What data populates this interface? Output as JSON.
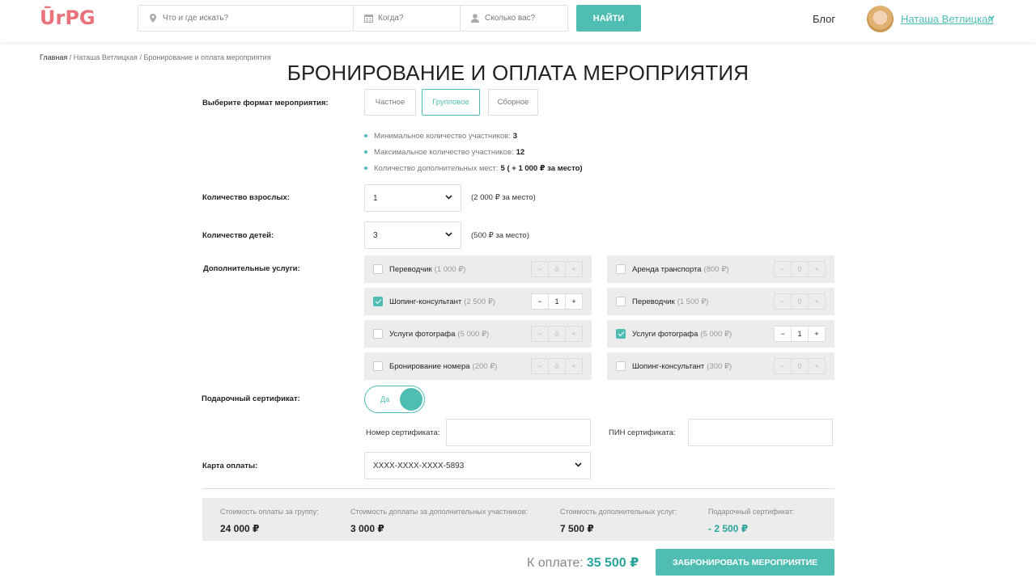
{
  "header": {
    "logo": "ŪrPG",
    "search": {
      "where_placeholder": "Что и где искать?",
      "when_placeholder": "Когда?",
      "who_placeholder": "Сколько вас?",
      "find_label": "НАЙТИ"
    },
    "blog_label": "Блог",
    "user_name": "Наташа Ветлицкая"
  },
  "breadcrumb": {
    "home": "Главная",
    "sep1": " / ",
    "user": "Наташа Ветлицкая",
    "sep2": " / ",
    "current": "Бронирование и оплата мероприятия"
  },
  "page_title": "БРОНИРОВАНИЕ И ОПЛАТА МЕРОПРИЯТИЯ",
  "format": {
    "label": "Выберите формат мероприятия:",
    "options": [
      "Частное",
      "Групповое",
      "Сборное"
    ],
    "selected": "Групповое"
  },
  "info": {
    "min_label": "Минимальное количество участников:",
    "min_value": "3",
    "max_label": "Максимальное количество участников:",
    "max_value": "12",
    "extra_label": "Количество дополнительных мест:",
    "extra_value": "5 ( + 1 000 ₽  за место)"
  },
  "adults": {
    "label": "Количество взрослых:",
    "value": "1",
    "note": "(2 000 ₽  за место)"
  },
  "children": {
    "label": "Количество детей:",
    "value": "3",
    "note": "(500 ₽  за место)"
  },
  "services": {
    "label": "Дополнительные услуги:",
    "left": [
      {
        "name": "Переводчик",
        "price": "(1 000 ₽)",
        "checked": false,
        "qty": "0"
      },
      {
        "name": "Шопинг-консультант",
        "price": "(2 500 ₽)",
        "checked": true,
        "qty": "1"
      },
      {
        "name": "Услуги фотографа",
        "price": "(5 000 ₽)",
        "checked": false,
        "qty": "0"
      },
      {
        "name": "Бронирование номера",
        "price": "(200 ₽)",
        "checked": false,
        "qty": "0"
      }
    ],
    "right": [
      {
        "name": "Аренда транспорта",
        "price": "(800 ₽)",
        "checked": false,
        "qty": "0"
      },
      {
        "name": "Переводчик",
        "price": "(1 500 ₽)",
        "checked": false,
        "qty": "0"
      },
      {
        "name": "Услуги фотографа",
        "price": "(5 000 ₽)",
        "checked": true,
        "qty": "1"
      },
      {
        "name": "Шопинг-консультант",
        "price": "(300 ₽)",
        "checked": false,
        "qty": "0"
      }
    ],
    "minus": "−",
    "plus": "+"
  },
  "gift": {
    "label": "Подарочный сертификат:",
    "toggle_text": "Да",
    "cert_number_label": "Номер сертификата:",
    "cert_pin_label": "ПИН сертификата:"
  },
  "payment": {
    "label": "Карта оплаты:",
    "card": "XXXX-XXXX-XXXX-5893"
  },
  "summary": {
    "group_label": "Стоимость оплаты за группу:",
    "group_value": "24 000 ₽",
    "extra_label": "Стоимость доплаты за дополнительных участников:",
    "extra_value": "3 000 ₽",
    "services_label": "Стоимость дополнительных услуг:",
    "services_value": "7 500 ₽",
    "gift_label": "Подарочный сертификат:",
    "gift_value": "- 2 500 ₽"
  },
  "total": {
    "label": "К оплате:",
    "value": "35 500 ₽"
  },
  "book_button": "ЗАБРОНИРОВАТЬ МЕРОПРИЯТИЕ",
  "colors": {
    "accent": "#4fbdb2",
    "logo": "#e9737d",
    "panel": "#ececec"
  }
}
